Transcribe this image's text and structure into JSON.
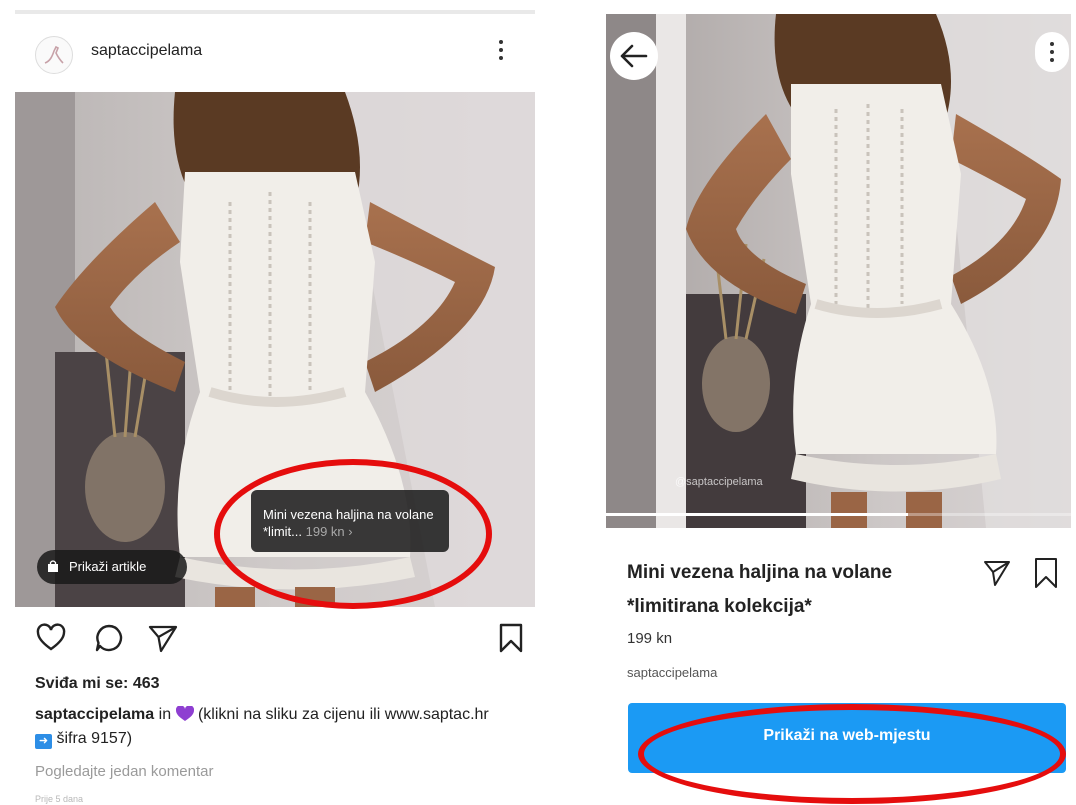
{
  "left_post": {
    "username": "saptaccipelama",
    "product_tag": {
      "name": "Mini vezena haljina na volane *limit...",
      "price": "199 kn",
      "chevron": "›"
    },
    "shop_button_label": "Prikaži artikle",
    "likes_text": "Sviđa mi se: 463",
    "caption": {
      "author": "saptaccipelama",
      "part1": " in ",
      "part2": " (klikni na sliku za cijenu ili www.saptac.hr",
      "part3": " šifra 9157)"
    },
    "comments_link": "Pogledajte jedan komentar",
    "timestamp": "Prije 5 dana"
  },
  "right_product": {
    "watermark": "@saptaccipelama",
    "title": "Mini vezena haljina na volane *limitirana kolekcija*",
    "price": "199 kn",
    "shop_name": "saptaccipelama",
    "web_button_label": "Prikaži na web-mjestu",
    "image_progress": 0.65
  },
  "icons": {
    "more": "more-vertical-icon",
    "back": "arrow-left-icon",
    "like": "heart-icon",
    "comment": "comment-icon",
    "share": "send-icon",
    "save": "bookmark-icon",
    "bag": "shopping-bag-icon"
  },
  "colors": {
    "accent_blue": "#1b9af4",
    "annotation_red": "#e50d0d",
    "heart_purple": "#8e3fd1",
    "arrow_blue": "#2d8ee6",
    "tag_bg": "#1e1e1e"
  }
}
